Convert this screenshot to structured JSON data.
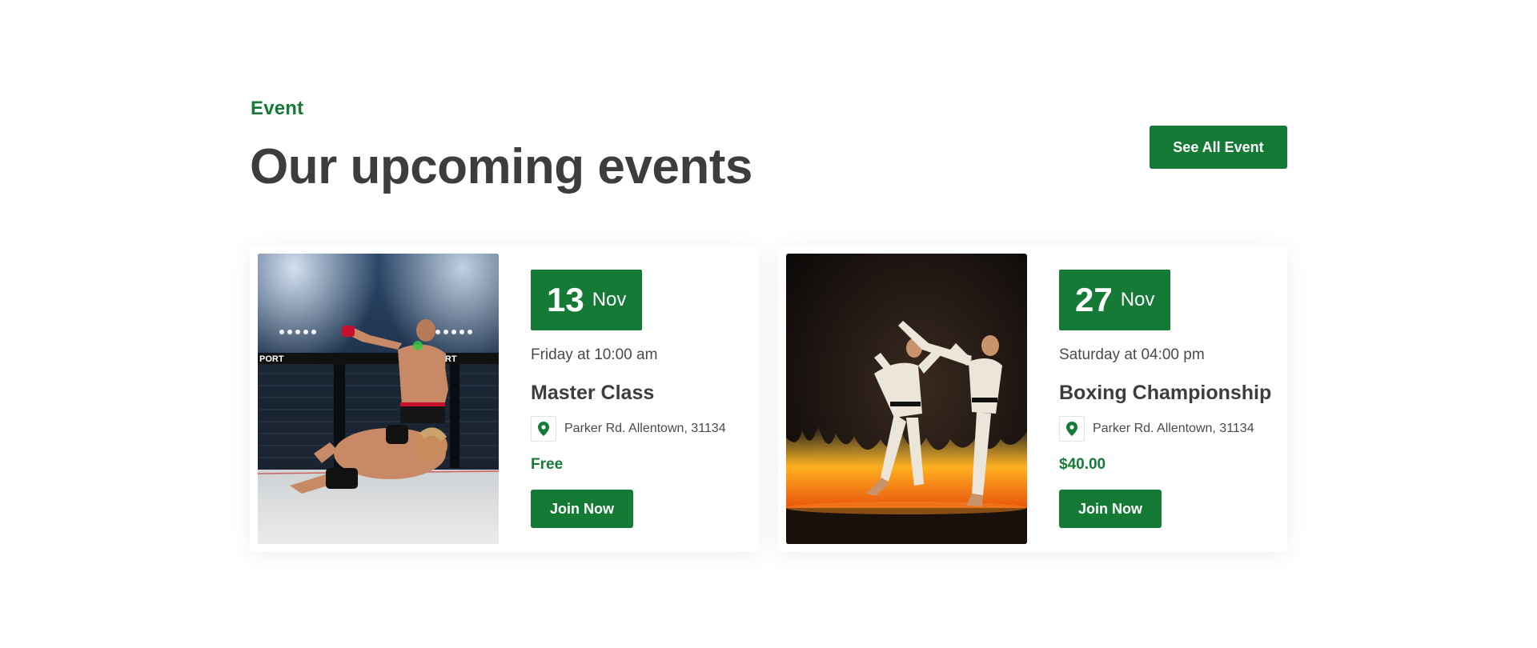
{
  "section": {
    "eyebrow": "Event",
    "heading": "Our upcoming events",
    "see_all_label": "See All Event"
  },
  "events": [
    {
      "day": "13",
      "month": "Nov",
      "when": "Friday at 10:00 am",
      "title": "Master Class",
      "location": "Parker Rd. Allentown, 31134",
      "location_icon": "map-pin-icon",
      "price": "Free",
      "join_label": "Join Now",
      "image_subject": "mma-fight-photo",
      "image_text": "PORT"
    },
    {
      "day": "27",
      "month": "Nov",
      "when": "Saturday at 04:00 pm",
      "title": "Boxing Championship",
      "location": "Parker Rd. Allentown, 31134",
      "location_icon": "map-pin-icon",
      "price": "$40.00",
      "join_label": "Join Now",
      "image_subject": "karate-fire-photo"
    }
  ],
  "colors": {
    "accent": "#147a35",
    "heading": "#3d3d3d",
    "text": "#4a4a4a",
    "background": "#ffffff"
  }
}
